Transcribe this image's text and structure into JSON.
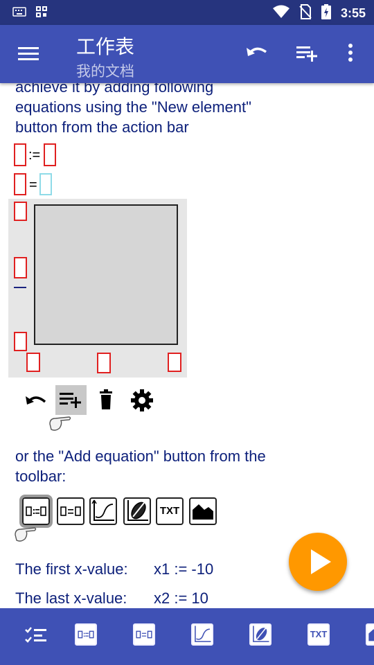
{
  "status_bar": {
    "time": "3:55"
  },
  "app_bar": {
    "title": "工作表",
    "subtitle": "我的文档",
    "icons": [
      "menu-icon",
      "undo-icon",
      "add-element-icon",
      "more-vert-icon"
    ]
  },
  "content": {
    "para1_partial": "achieve it by adding following",
    "para1_line2": "equations using the \"New element\"",
    "para1_line3": "button from the action bar",
    "assign_operator": ":=",
    "equals_operator": "=",
    "para2_line1": "or the \"Add equation\" button from the",
    "para2_line2": "toolbar:",
    "txt_label": "TXT",
    "row1_label": "The first x-value:",
    "row1_value": "x1 := -10",
    "row2_label": "The last x-value:",
    "row2_value": "x2 := 10"
  },
  "bottom_bar": {
    "txt_label": "TXT",
    "icons": [
      "checklist-icon",
      "assign-equation-icon",
      "equation-icon",
      "function-plot-icon",
      "parametric-plot-icon",
      "text-icon",
      "image-icon"
    ]
  },
  "colors": {
    "primary": "#3f51b5",
    "status_bar": "#26347e",
    "text": "#0c1f7a",
    "accent": "#ff9800",
    "placeholder": "#e02020"
  }
}
